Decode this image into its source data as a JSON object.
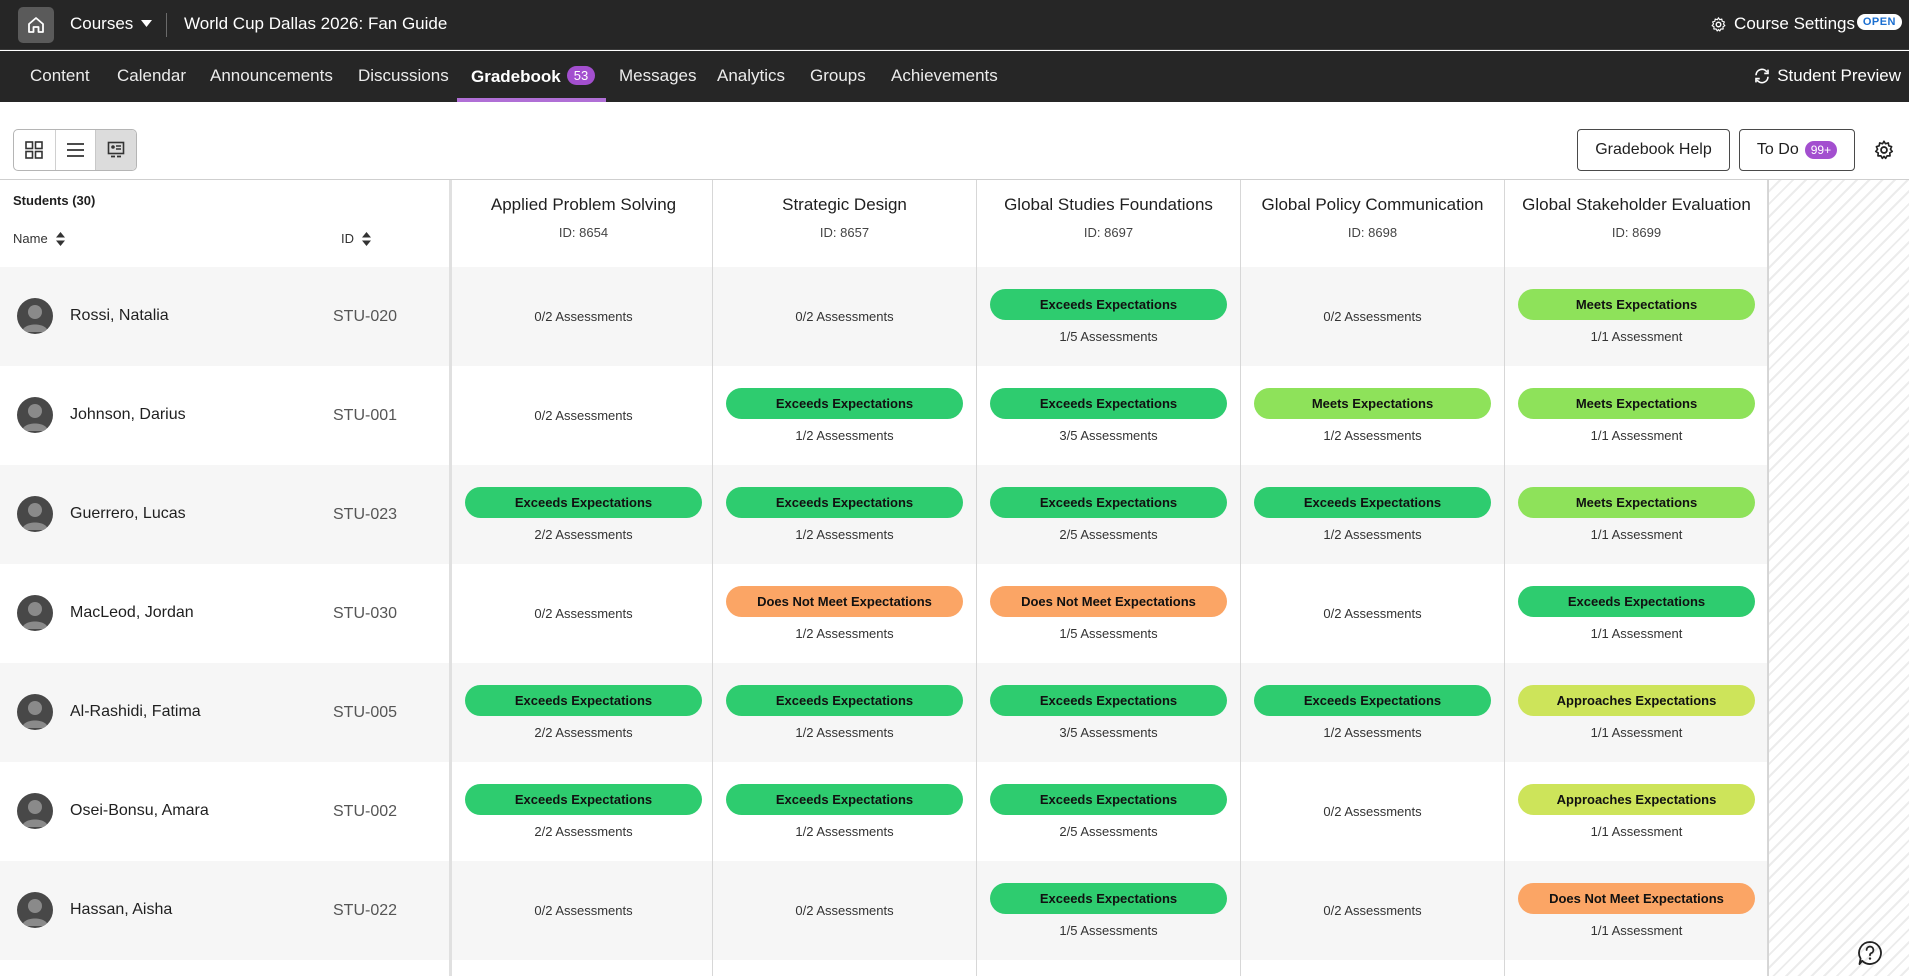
{
  "topbar": {
    "courses_label": "Courses",
    "course_title": "World Cup Dallas 2026: Fan Guide",
    "settings_label": "Course Settings",
    "open_badge": "OPEN"
  },
  "nav": {
    "tabs": [
      "Content",
      "Calendar",
      "Announcements",
      "Discussions",
      "Gradebook",
      "Messages",
      "Analytics",
      "Groups",
      "Achievements"
    ],
    "active_tab": "Gradebook",
    "gradebook_count": "53",
    "student_preview": "Student Preview"
  },
  "toolbar": {
    "help_label": "Gradebook Help",
    "todo_label": "To Do",
    "todo_count": "99+"
  },
  "grid": {
    "students_label": "Students (30)",
    "name_header": "Name",
    "id_header": "ID",
    "columns": [
      {
        "title": "Applied Problem Solving",
        "id": "ID: 8654"
      },
      {
        "title": "Strategic Design",
        "id": "ID: 8657"
      },
      {
        "title": "Global Studies Foundations",
        "id": "ID: 8697"
      },
      {
        "title": "Global Policy Communication",
        "id": "ID: 8698"
      },
      {
        "title": "Global Stakeholder Evaluation",
        "id": "ID: 8699"
      }
    ],
    "rows": [
      {
        "name": "Rossi, Natalia",
        "id": "STU-020",
        "cells": [
          {
            "status": "",
            "assess": "0/2 Assessments"
          },
          {
            "status": "",
            "assess": "0/2 Assessments"
          },
          {
            "status": "Exceeds Expectations",
            "assess": "1/5 Assessments"
          },
          {
            "status": "",
            "assess": "0/2 Assessments"
          },
          {
            "status": "Meets Expectations",
            "assess": "1/1 Assessment"
          }
        ]
      },
      {
        "name": "Johnson, Darius",
        "id": "STU-001",
        "cells": [
          {
            "status": "",
            "assess": "0/2 Assessments"
          },
          {
            "status": "Exceeds Expectations",
            "assess": "1/2 Assessments"
          },
          {
            "status": "Exceeds Expectations",
            "assess": "3/5 Assessments"
          },
          {
            "status": "Meets Expectations",
            "assess": "1/2 Assessments"
          },
          {
            "status": "Meets Expectations",
            "assess": "1/1 Assessment"
          }
        ]
      },
      {
        "name": "Guerrero, Lucas",
        "id": "STU-023",
        "cells": [
          {
            "status": "Exceeds Expectations",
            "assess": "2/2 Assessments"
          },
          {
            "status": "Exceeds Expectations",
            "assess": "1/2 Assessments"
          },
          {
            "status": "Exceeds Expectations",
            "assess": "2/5 Assessments"
          },
          {
            "status": "Exceeds Expectations",
            "assess": "1/2 Assessments"
          },
          {
            "status": "Meets Expectations",
            "assess": "1/1 Assessment"
          }
        ]
      },
      {
        "name": "MacLeod, Jordan",
        "id": "STU-030",
        "cells": [
          {
            "status": "",
            "assess": "0/2 Assessments"
          },
          {
            "status": "Does Not Meet Expectations",
            "assess": "1/2 Assessments"
          },
          {
            "status": "Does Not Meet Expectations",
            "assess": "1/5 Assessments"
          },
          {
            "status": "",
            "assess": "0/2 Assessments"
          },
          {
            "status": "Exceeds Expectations",
            "assess": "1/1 Assessment"
          }
        ]
      },
      {
        "name": "Al-Rashidi, Fatima",
        "id": "STU-005",
        "cells": [
          {
            "status": "Exceeds Expectations",
            "assess": "2/2 Assessments"
          },
          {
            "status": "Exceeds Expectations",
            "assess": "1/2 Assessments"
          },
          {
            "status": "Exceeds Expectations",
            "assess": "3/5 Assessments"
          },
          {
            "status": "Exceeds Expectations",
            "assess": "1/2 Assessments"
          },
          {
            "status": "Approaches Expectations",
            "assess": "1/1 Assessment"
          }
        ]
      },
      {
        "name": "Osei-Bonsu, Amara",
        "id": "STU-002",
        "cells": [
          {
            "status": "Exceeds Expectations",
            "assess": "2/2 Assessments"
          },
          {
            "status": "Exceeds Expectations",
            "assess": "1/2 Assessments"
          },
          {
            "status": "Exceeds Expectations",
            "assess": "2/5 Assessments"
          },
          {
            "status": "",
            "assess": "0/2 Assessments"
          },
          {
            "status": "Approaches Expectations",
            "assess": "1/1 Assessment"
          }
        ]
      },
      {
        "name": "Hassan, Aisha",
        "id": "STU-022",
        "cells": [
          {
            "status": "",
            "assess": "0/2 Assessments"
          },
          {
            "status": "",
            "assess": "0/2 Assessments"
          },
          {
            "status": "Exceeds Expectations",
            "assess": "1/5 Assessments"
          },
          {
            "status": "",
            "assess": "0/2 Assessments"
          },
          {
            "status": "Does Not Meet Expectations",
            "assess": "1/1 Assessment"
          }
        ]
      }
    ]
  },
  "status_colors": {
    "Exceeds Expectations": "#2ecc6f",
    "Meets Expectations": "#8ee25a",
    "Approaches Expectations": "#cde45a",
    "Does Not Meet Expectations": "#fba565"
  },
  "icons": {
    "home": "home-icon",
    "caret": "caret-down-icon",
    "settings": "gear-icon",
    "preview": "refresh-icon",
    "grid_view": "grid-icon",
    "list_view": "list-icon",
    "roster_view": "roster-icon",
    "sort": "sort-icon",
    "avatar": "user-avatar-icon",
    "help": "help-icon"
  }
}
